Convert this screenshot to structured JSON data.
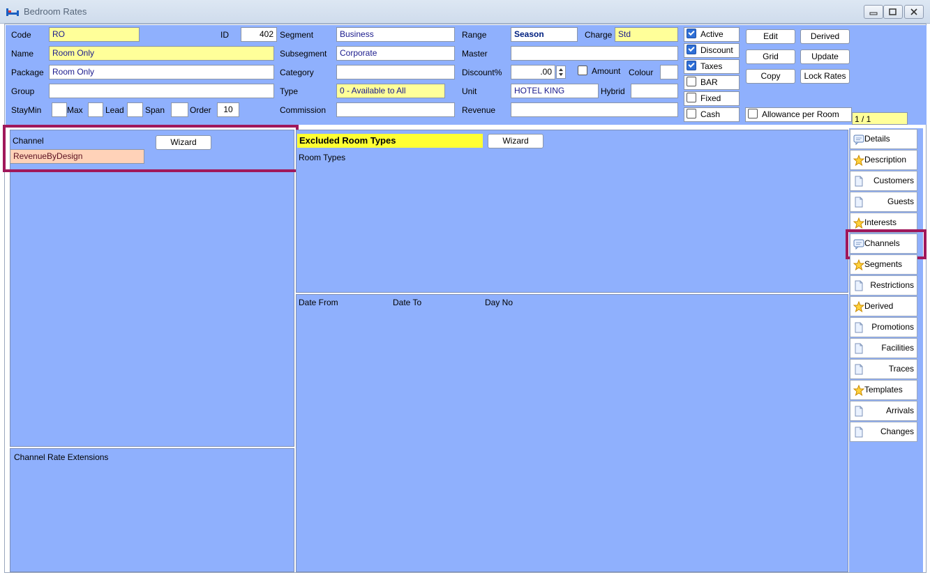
{
  "window": {
    "title": "Bedroom Rates"
  },
  "header": {
    "code_label": "Code",
    "code": "RO",
    "id_label": "ID",
    "id": "402",
    "name_label": "Name",
    "name": "Room Only",
    "package_label": "Package",
    "package": "Room Only",
    "group_label": "Group",
    "group": "",
    "staymin_label": "StayMin",
    "max_label": "Max",
    "lead_label": "Lead",
    "span_label": "Span",
    "order_label": "Order",
    "order": "10",
    "segment_label": "Segment",
    "segment": "Business",
    "subsegment_label": "Subsegment",
    "subsegment": "Corporate",
    "category_label": "Category",
    "category": "",
    "type_label": "Type",
    "type": "0 - Available to All",
    "commission_label": "Commission",
    "commission": "",
    "range_label": "Range",
    "range": "Season",
    "charge_label": "Charge",
    "charge": "Std",
    "master_label": "Master",
    "master": "",
    "discount_pct_label": "Discount%",
    "discount_pct": ".00",
    "amount_label": "Amount",
    "colour_label": "Colour",
    "colour": "",
    "unit_label": "Unit",
    "unit": "HOTEL KING",
    "hybrid_label": "Hybrid",
    "hybrid": "",
    "revenue_label": "Revenue",
    "revenue": "",
    "active_label": "Active",
    "discount_label": "Discount",
    "taxes_label": "Taxes",
    "bar_label": "BAR",
    "fixed_label": "Fixed",
    "cash_label": "Cash",
    "allowance_label": "Allowance per Room",
    "record_counter": "1 / 1"
  },
  "buttons": {
    "edit": "Edit",
    "derived": "Derived",
    "grid": "Grid",
    "update": "Update",
    "copy": "Copy",
    "lock_rates": "Lock Rates"
  },
  "channel_panel": {
    "label": "Channel",
    "wizard": "Wizard",
    "value": "RevenueByDesign",
    "extensions_label": "Channel Rate Extensions"
  },
  "excluded_panel": {
    "title": "Excluded Room Types",
    "wizard": "Wizard",
    "room_types_label": "Room Types",
    "columns": [
      "Date From",
      "Date To",
      "Day No"
    ]
  },
  "tabs": [
    {
      "label": "Details",
      "icon": "speech-icon"
    },
    {
      "label": "Description",
      "icon": "star-icon"
    },
    {
      "label": "Customers",
      "icon": "page-icon"
    },
    {
      "label": "Guests",
      "icon": "page-icon"
    },
    {
      "label": "Interests",
      "icon": "star-icon"
    },
    {
      "label": "Channels",
      "icon": "speech-icon"
    },
    {
      "label": "Segments",
      "icon": "star-icon"
    },
    {
      "label": "Restrictions",
      "icon": "page-icon"
    },
    {
      "label": "Derived",
      "icon": "star-icon"
    },
    {
      "label": "Promotions",
      "icon": "page-icon"
    },
    {
      "label": "Facilities",
      "icon": "page-icon"
    },
    {
      "label": "Traces",
      "icon": "page-icon"
    },
    {
      "label": "Templates",
      "icon": "star-icon"
    },
    {
      "label": "Arrivals",
      "icon": "page-icon"
    },
    {
      "label": "Changes",
      "icon": "page-icon"
    }
  ],
  "colors": {
    "panel_blue": "#8fb0fd",
    "field_yellow": "#ffff99",
    "highlight": "#a0185b",
    "channel_value": "#ffd2b8"
  }
}
